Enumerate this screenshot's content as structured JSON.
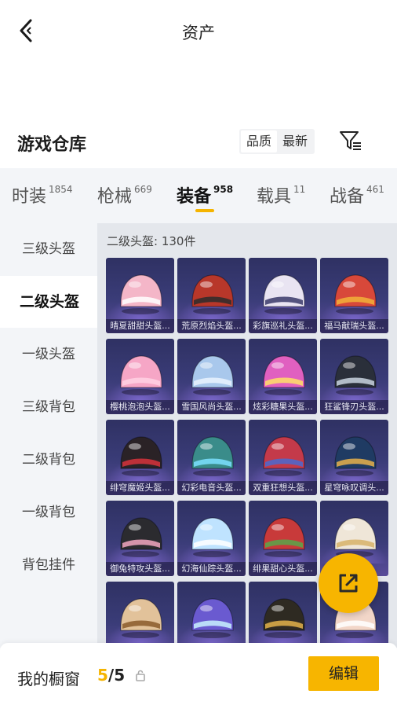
{
  "header": {
    "title": "资产"
  },
  "section": {
    "title": "游戏仓库",
    "sort_options": [
      "品质",
      "最新"
    ],
    "active_sort": "品质"
  },
  "tabs": [
    {
      "label": "时装",
      "count": "1854"
    },
    {
      "label": "枪械",
      "count": "669"
    },
    {
      "label": "装备",
      "count": "958"
    },
    {
      "label": "载具",
      "count": "11"
    },
    {
      "label": "战备",
      "count": "461"
    }
  ],
  "sidebar": {
    "items": [
      {
        "label": "三级头盔"
      },
      {
        "label": "二级头盔"
      },
      {
        "label": "一级头盔"
      },
      {
        "label": "三级背包"
      },
      {
        "label": "二级背包"
      },
      {
        "label": "一级背包"
      },
      {
        "label": "背包挂件"
      }
    ]
  },
  "grid": {
    "header": "二级头盔: 130件",
    "items": [
      {
        "name": "晴夏甜甜头盔...",
        "color": "#f4b6c8",
        "accent": "#ffffff"
      },
      {
        "name": "荒原烈焰头盔...",
        "color": "#b8372a",
        "accent": "#2b2b2b"
      },
      {
        "name": "彩旗巡礼头盔...",
        "color": "#e9e4f2",
        "accent": "#3a3a6a"
      },
      {
        "name": "福马献瑞头盔...",
        "color": "#d8483a",
        "accent": "#f2b23a"
      },
      {
        "name": "樱桃泡泡头盔...",
        "color": "#f6a6c6",
        "accent": "#ffd1e3"
      },
      {
        "name": "雪国风尚头盔...",
        "color": "#a9c8ec",
        "accent": "#eaf3ff"
      },
      {
        "name": "炫彩糖果头盔...",
        "color": "#e060c0",
        "accent": "#ffe066"
      },
      {
        "name": "狂鲨锋刃头盔...",
        "color": "#2a2f3a",
        "accent": "#c9d3e0"
      },
      {
        "name": "绯穹魔姬头盔...",
        "color": "#2a2226",
        "accent": "#d8323c"
      },
      {
        "name": "幻彩电音头盔...",
        "color": "#3a8c8a",
        "accent": "#7de0ff"
      },
      {
        "name": "双重狂想头盔...",
        "color": "#c43a4a",
        "accent": "#4a6ad0"
      },
      {
        "name": "星穹咏叹调头...",
        "color": "#1f3b63",
        "accent": "#e8b24a"
      },
      {
        "name": "御兔特攻头盔...",
        "color": "#2b2b2f",
        "accent": "#f2a7c0"
      },
      {
        "name": "幻海仙踪头盔...",
        "color": "#bfe3ff",
        "accent": "#ffffff"
      },
      {
        "name": "绯果甜心头盔...",
        "color": "#c83a3a",
        "accent": "#58a84a"
      },
      {
        "name": "",
        "color": "#efe6d8",
        "accent": "#d7b26a"
      },
      {
        "name": "",
        "color": "#e2c29a",
        "accent": "#8a5a2a"
      },
      {
        "name": "",
        "color": "#6a5ad0",
        "accent": "#c8f2ff"
      },
      {
        "name": "",
        "color": "#2e2a22",
        "accent": "#e2b24a"
      },
      {
        "name": "",
        "color": "#f2d6c8",
        "accent": "#ffffff"
      }
    ]
  },
  "bottom": {
    "label": "我的橱窗",
    "count_current": "5",
    "count_sep": "/",
    "count_total": "5",
    "edit_label": "编辑"
  },
  "icons": {
    "back": "back-arrow-icon",
    "filter": "filter-icon",
    "share": "share-icon",
    "lock": "lock-icon"
  },
  "colors": {
    "accent": "#f5b400",
    "card_bg": "#34366d"
  }
}
